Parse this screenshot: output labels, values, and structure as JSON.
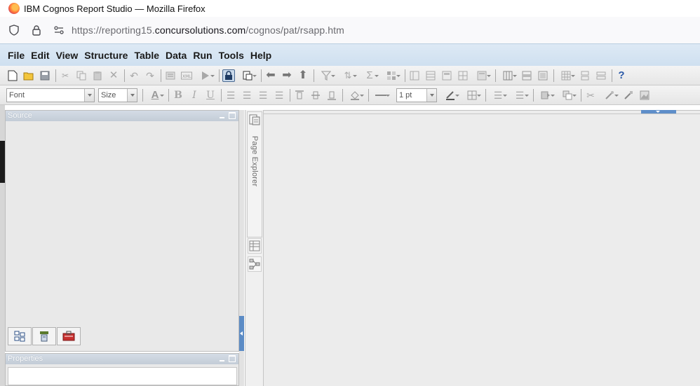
{
  "window": {
    "title": "IBM Cognos Report Studio — Mozilla Firefox"
  },
  "urlbar": {
    "url_prefix": "https://reporting15.",
    "url_domain": "concursolutions.com",
    "url_path": "/cognos/pat/rsapp.htm"
  },
  "menubar": {
    "items": [
      "File",
      "Edit",
      "View",
      "Structure",
      "Table",
      "Data",
      "Run",
      "Tools",
      "Help"
    ]
  },
  "toolbar2": {
    "font_placeholder": "Font",
    "size_placeholder": "Size",
    "line_weight": "1 pt"
  },
  "panes": {
    "source_title": "Source",
    "properties_title": "Properties"
  },
  "page_explorer": {
    "label": "Page Explorer"
  },
  "colors": {
    "menubar_bg": "#d6e5f3",
    "accent_blue": "#5b8bc5",
    "workarea_bg": "#ececec"
  }
}
